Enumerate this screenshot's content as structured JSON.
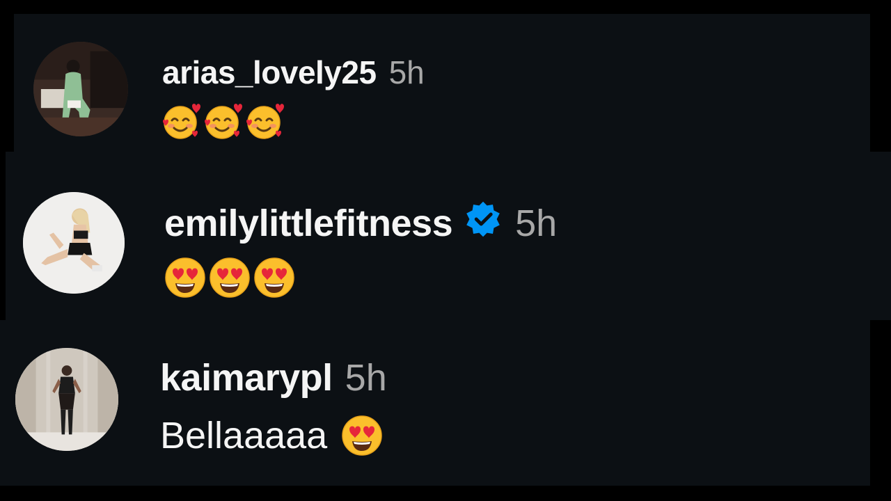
{
  "colors": {
    "background": "#000000",
    "panel": "#0c1014",
    "username": "#f5f5f5",
    "timestamp": "#a8a8a8",
    "verified": "#0095f6"
  },
  "comments": [
    {
      "username": "arias_lovely25",
      "time": "5h",
      "verified": false,
      "text": "",
      "emojis": [
        "smiling-face-with-hearts-icon",
        "smiling-face-with-hearts-icon",
        "smiling-face-with-hearts-icon"
      ]
    },
    {
      "username": "emilylittlefitness",
      "time": "5h",
      "verified": true,
      "text": "",
      "emojis": [
        "heart-eyes-icon",
        "heart-eyes-icon",
        "heart-eyes-icon"
      ]
    },
    {
      "username": "kaimarypl",
      "time": "5h",
      "verified": false,
      "text": "Bellaaaaa",
      "emojis": [
        "heart-eyes-icon"
      ]
    }
  ]
}
